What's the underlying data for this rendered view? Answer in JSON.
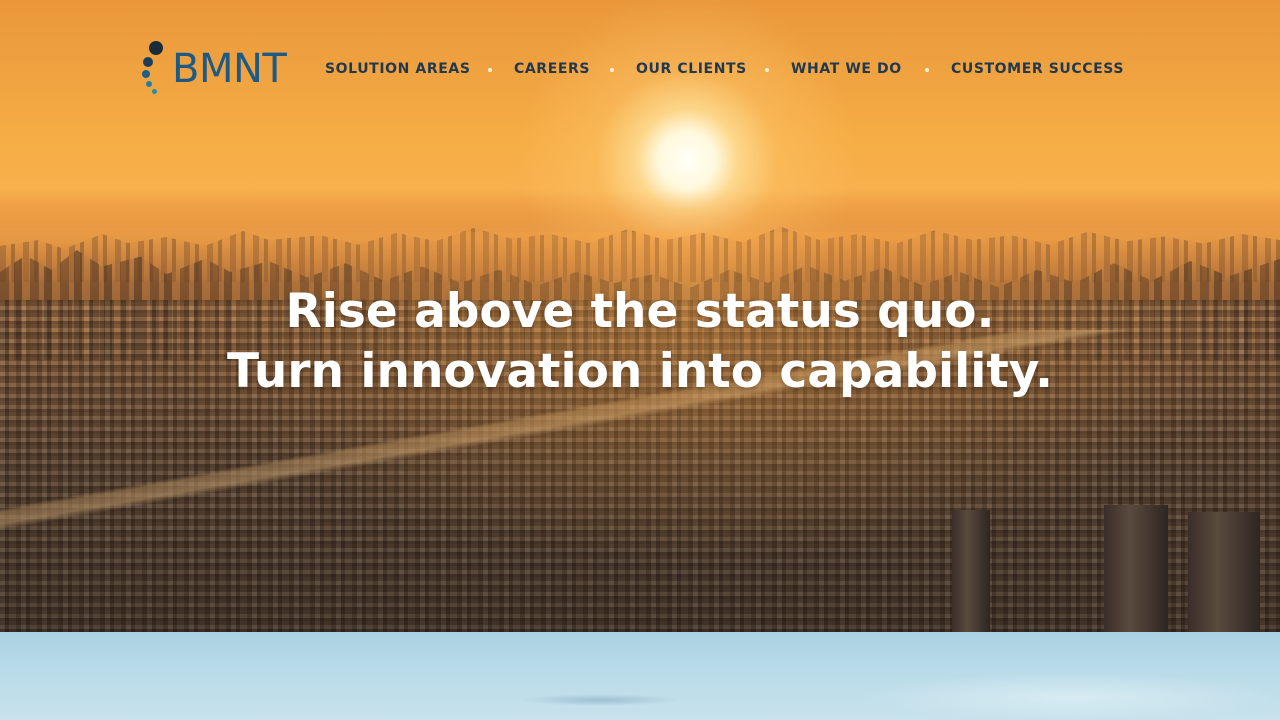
{
  "brand": {
    "logo_text": "BMNT",
    "colors": {
      "logo_blue": "#1d5a86",
      "logo_dot_dark": "#1a2c3c",
      "logo_dot_teal": "#1f8fb0",
      "nav_text": "#21384f"
    }
  },
  "nav": {
    "items": [
      {
        "label": "SOLUTION AREAS"
      },
      {
        "label": "CAREERS"
      },
      {
        "label": "OUR CLIENTS"
      },
      {
        "label": "WHAT WE DO"
      },
      {
        "label": "CUSTOMER SUCCESS"
      }
    ]
  },
  "hero": {
    "headline_line1": "Rise above the status quo.",
    "headline_line2": "Turn innovation into capability."
  }
}
